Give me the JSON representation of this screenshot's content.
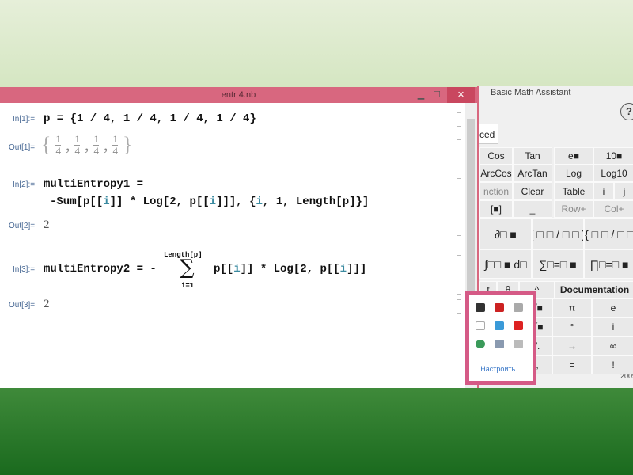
{
  "window": {
    "title": "entr 4.nb",
    "minimize": "▁",
    "maximize": "☐",
    "close": "✕"
  },
  "cells": [
    {
      "in_label": "In[1]:=",
      "input": "p = {1 / 4, 1 / 4, 1 / 4, 1 / 4}",
      "out_label": "Out[1]=",
      "output_fractions": [
        "1",
        "4"
      ]
    },
    {
      "in_label": "In[2]:=",
      "input_line1": "multiEntropy1 =",
      "input_line2_a": "-Sum[p[[",
      "i": "i",
      "input_line2_b": "]] * Log[2, p[[",
      "input_line2_c": "]]], {",
      "input_line2_d": ", 1, Length[p]}]",
      "out_label": "Out[2]=",
      "output": "2"
    },
    {
      "in_label": "In[3]:=",
      "input_a": "multiEntropy2 = -",
      "sum_upper": "Length[p]",
      "sum_symbol": "∑",
      "sum_lower": "i=1",
      "input_b": "p[[",
      "input_c": "]] * Log[2, p[[",
      "input_d": "]]]",
      "out_label": "Out[3]=",
      "output": "2"
    }
  ],
  "palette": {
    "title": "Basic Math Assistant",
    "help": "?",
    "tab": "ced",
    "rows": [
      [
        "Cos",
        "Tan",
        "e■",
        "10■"
      ],
      [
        "ArcCos",
        "ArcTan",
        "Log",
        "Log10"
      ],
      [
        "nction",
        "Clear",
        "Table",
        "i",
        "j"
      ],
      [
        "[■]",
        "_",
        "Row+",
        "Col+"
      ],
      [
        "∂□ ■",
        "( □ □ / □ □ )",
        "{ □ □ / □ □"
      ],
      [
        "∫□□ ■ d□",
        "∑□=□ ■",
        "∏□=□ ■"
      ],
      [
        "t",
        "θ",
        "^",
        "Documentation"
      ],
      [
        "■/□",
        "√■",
        "π",
        "e"
      ],
      [
        "■□",
        "∛■",
        "°",
        "i"
      ],
      [
        "(■)",
        "/.",
        "→",
        "∞"
      ],
      [
        "{■}",
        ",",
        "=",
        "!"
      ]
    ],
    "footer": "2009"
  },
  "tray_popup": {
    "customize": "Настроить..."
  },
  "colors": {
    "accent": "#d8677f",
    "popup_border": "#d55a86",
    "variable": "#3a8aa0"
  }
}
